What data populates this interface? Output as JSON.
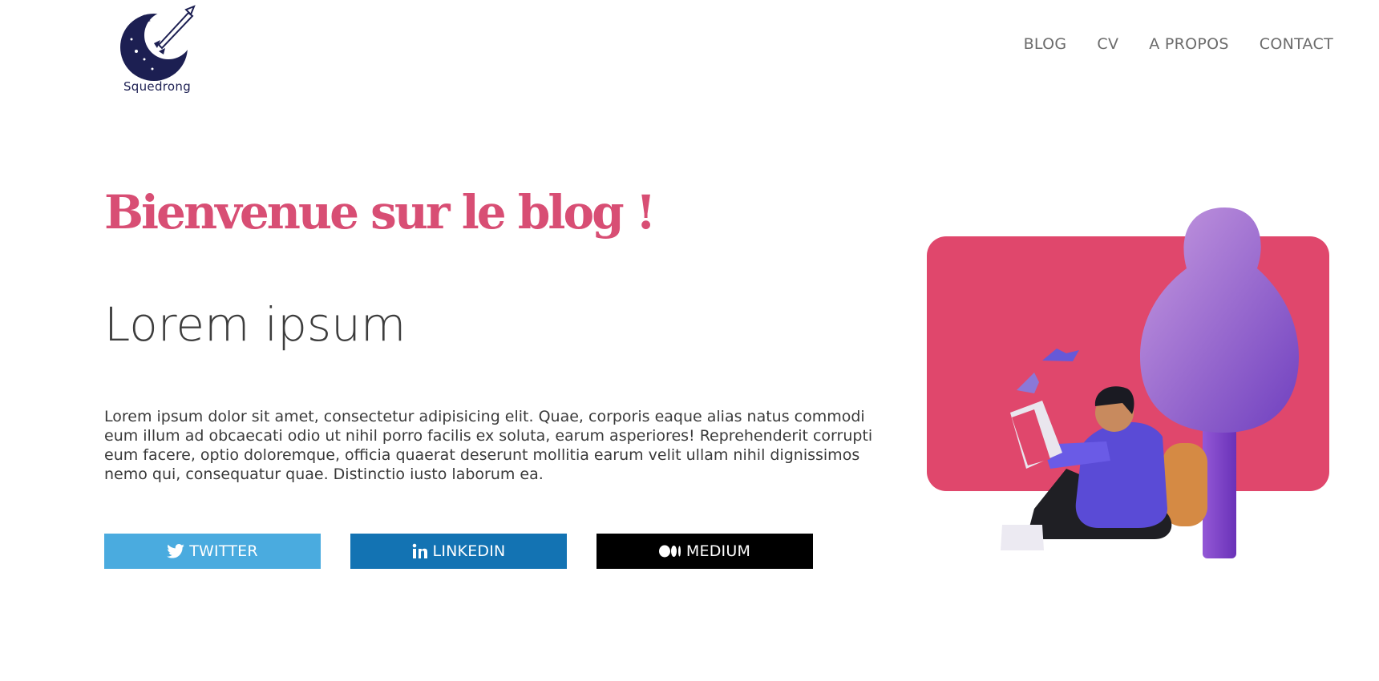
{
  "header": {
    "logo_text": "Squedrong",
    "nav": [
      "BLOG",
      "CV",
      "A PROPOS",
      "CONTACT"
    ]
  },
  "hero": {
    "title": "Bienvenue sur le blog !",
    "subtitle": "Lorem ipsum",
    "body": "Lorem ipsum dolor sit amet, consectetur adipisicing elit. Quae, corporis eaque alias natus commodi eum illum ad obcaecati odio ut nihil porro facilis ex soluta, earum asperiores! Reprehenderit corrupti eum facere, optio doloremque, officia quaerat deserunt mollitia earum velit ullam nihil dignissimos nemo qui, consequatur quae. Distinctio iusto laborum ea."
  },
  "social": {
    "twitter": {
      "label": "TWITTER",
      "icon": "twitter-bird-icon",
      "color": "#4aabdf"
    },
    "linkedin": {
      "label": "LINKEDIN",
      "icon": "linkedin-in-icon",
      "color": "#1373b3"
    },
    "medium": {
      "label": "MEDIUM",
      "icon": "medium-dots-icon",
      "color": "#000000"
    }
  },
  "colors": {
    "title": "#d84e74",
    "card": "#e0476c",
    "tree": "#9a63c9"
  }
}
